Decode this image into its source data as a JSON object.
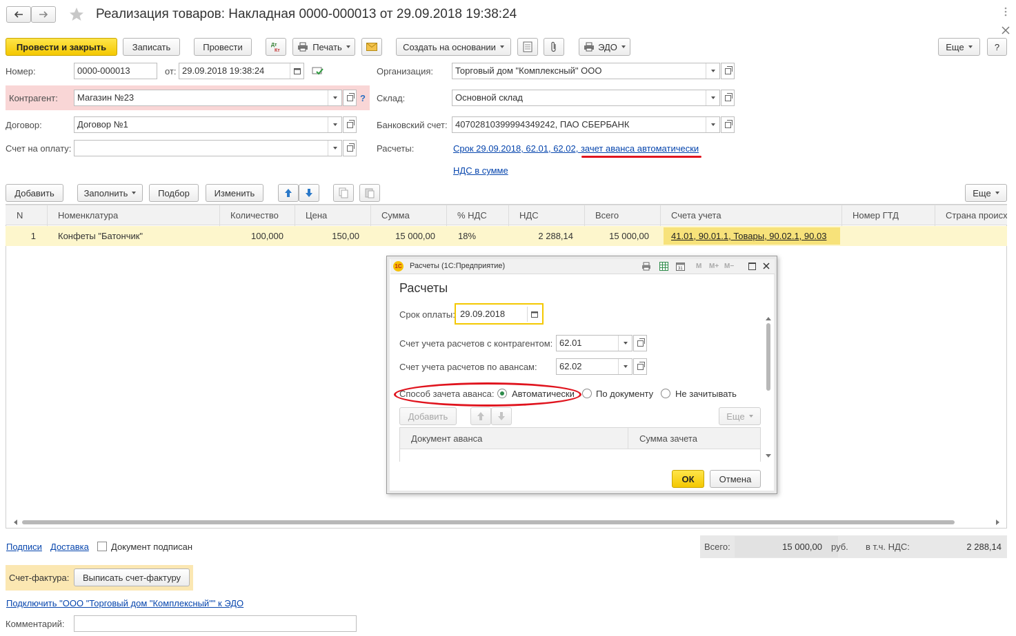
{
  "window": {
    "title": "Реализация товаров: Накладная 0000-000013 от 29.09.2018 19:38:24"
  },
  "toolbar": {
    "post_close": "Провести и закрыть",
    "save": "Записать",
    "post": "Провести",
    "print": "Печать",
    "create_based": "Создать на основании",
    "edo": "ЭДО",
    "more": "Еще",
    "help": "?"
  },
  "header": {
    "number_label": "Номер:",
    "number_value": "0000-000013",
    "date_label": "от:",
    "date_value": "29.09.2018 19:38:24",
    "counterparty_label": "Контрагент:",
    "counterparty_value": "Магазин №23",
    "contract_label": "Договор:",
    "contract_value": "Договор №1",
    "invoice_label": "Счет на оплату:",
    "invoice_value": "",
    "org_label": "Организация:",
    "org_value": "Торговый дом \"Комплексный\" ООО",
    "warehouse_label": "Склад:",
    "warehouse_value": "Основной склад",
    "bank_label": "Банковский счет:",
    "bank_value": "40702810399994349242, ПАО СБЕРБАНК",
    "settlements_label": "Расчеты:",
    "settlements_link": "Срок 29.09.2018, 62.01, 62.02, зачет аванса автоматически",
    "vat_link": "НДС в сумме"
  },
  "table_toolbar": {
    "add": "Добавить",
    "fill": "Заполнить",
    "pick": "Подбор",
    "change": "Изменить",
    "more": "Еще"
  },
  "table": {
    "columns": [
      "N",
      "Номенклатура",
      "Количество",
      "Цена",
      "Сумма",
      "% НДС",
      "НДС",
      "Всего",
      "Счета учета",
      "Номер ГТД",
      "Страна происх"
    ],
    "rows": [
      {
        "n": "1",
        "item": "Конфеты \"Батончик\"",
        "qty": "100,000",
        "price": "150,00",
        "sum": "15 000,00",
        "vat_rate": "18%",
        "vat": "2 288,14",
        "total": "15 000,00",
        "accounts": "41.01, 90.01.1, Товары, 90.02.1, 90.03",
        "gtd": "",
        "country": ""
      }
    ]
  },
  "dialog": {
    "title": "Расчеты (1С:Предприятие)",
    "heading": "Расчеты",
    "due_label": "Срок оплаты:",
    "due_value": "29.09.2018",
    "acct_contr_label": "Счет учета расчетов с контрагентом:",
    "acct_contr_value": "62.01",
    "acct_adv_label": "Счет учета расчетов по авансам:",
    "acct_adv_value": "62.02",
    "method_label": "Способ зачета аванса:",
    "opt_auto": "Автоматически",
    "opt_doc": "По документу",
    "opt_none": "Не зачитывать",
    "add": "Добавить",
    "more": "Еще",
    "col_doc": "Документ аванса",
    "col_sum": "Сумма зачета",
    "ok": "ОК",
    "cancel": "Отмена",
    "title_icons": [
      "M",
      "M+",
      "M−"
    ]
  },
  "footer": {
    "signatures_link": "Подписи",
    "delivery_link": "Доставка",
    "signed_label": "Документ подписан",
    "total_label": "Всего:",
    "total_value": "15 000,00",
    "currency": "руб.",
    "vat_incl_label": "в т.ч. НДС:",
    "vat_incl_value": "2 288,14",
    "invoice_label": "Счет-фактура:",
    "invoice_button": "Выписать счет-фактуру",
    "connect_link": "Подключить \"ООО \"Торговый дом \"Комплексный\"\" к ЭДО",
    "comment_label": "Комментарий:",
    "comment_value": ""
  },
  "colors": {
    "accent_yellow": "#f4c800",
    "row_highlight": "#fdf6cc",
    "error_pink": "#f9d6d6",
    "link_blue": "#0645ad",
    "annotation_red": "#e0141e"
  }
}
